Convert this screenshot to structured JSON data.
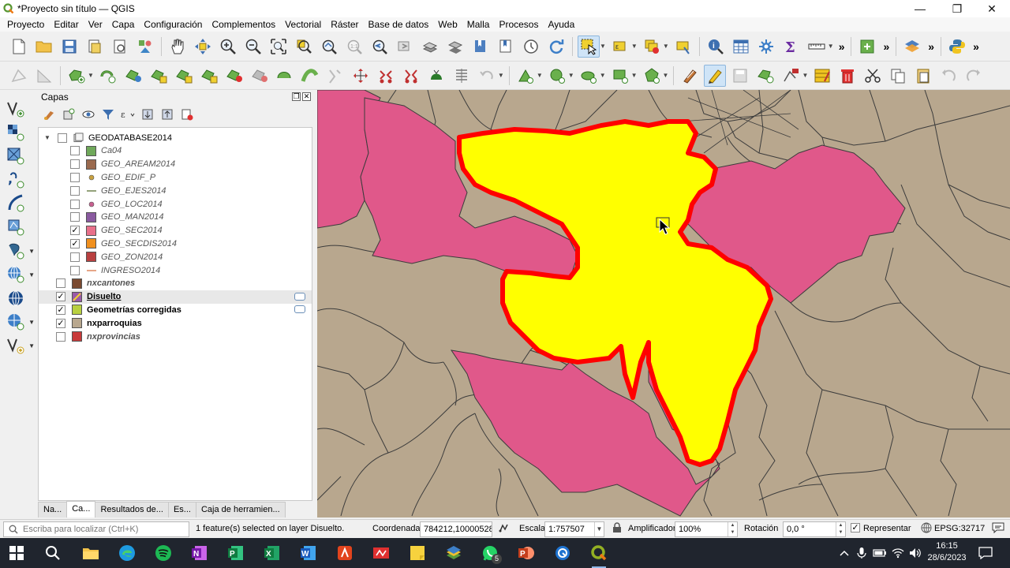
{
  "window": {
    "title": "*Proyecto sin título — QGIS",
    "minimize": "—",
    "restore": "❐",
    "close": "✕"
  },
  "menubar": [
    "Proyecto",
    "Editar",
    "Ver",
    "Capa",
    "Configuración",
    "Complementos",
    "Vectorial",
    "Ráster",
    "Base de datos",
    "Web",
    "Malla",
    "Procesos",
    "Ayuda"
  ],
  "layers_panel": {
    "title": "Capas",
    "tree": [
      {
        "name": "GEODATABASE2014",
        "type": "group",
        "checked": false,
        "level": 0,
        "style": "normal"
      },
      {
        "name": "Ca04",
        "type": "polygon",
        "color": "#6fa85a",
        "checked": false,
        "level": 1,
        "style": "italic"
      },
      {
        "name": "GEO_AREAM2014",
        "type": "polygon",
        "color": "#9a6a4e",
        "checked": false,
        "level": 1,
        "style": "italic"
      },
      {
        "name": "GEO_EDIF_P",
        "type": "point",
        "color": "#c8a040",
        "checked": false,
        "level": 1,
        "style": "italic"
      },
      {
        "name": "GEO_EJES2014",
        "type": "line",
        "color": "#7a8a5a",
        "checked": false,
        "level": 1,
        "style": "italic"
      },
      {
        "name": "GEO_LOC2014",
        "type": "point",
        "color": "#c86090",
        "checked": false,
        "level": 1,
        "style": "italic"
      },
      {
        "name": "GEO_MAN2014",
        "type": "polygon",
        "color": "#8a5aa0",
        "checked": false,
        "level": 1,
        "style": "italic"
      },
      {
        "name": "GEO_SEC2014",
        "type": "polygon",
        "color": "#e8708a",
        "checked": true,
        "level": 1,
        "style": "italic"
      },
      {
        "name": "GEO_SECDIS2014",
        "type": "polygon",
        "color": "#f0901e",
        "checked": true,
        "level": 1,
        "style": "italic"
      },
      {
        "name": "GEO_ZON2014",
        "type": "polygon",
        "color": "#b84040",
        "checked": false,
        "level": 1,
        "style": "italic"
      },
      {
        "name": "INGRESO2014",
        "type": "line",
        "color": "#e0906a",
        "checked": false,
        "level": 1,
        "style": "italic"
      },
      {
        "name": "nxcantones",
        "type": "polygon",
        "color": "#7a4a30",
        "checked": false,
        "level": 0,
        "style": "italic-bold"
      },
      {
        "name": "Disuelto",
        "type": "polygon-selected",
        "color": "#9a5aa8",
        "checked": true,
        "level": 0,
        "style": "bold-underline",
        "editing": true
      },
      {
        "name": "Geometrías corregidas",
        "type": "polygon",
        "color": "#b8d040",
        "checked": true,
        "level": 0,
        "style": "bold",
        "editing": true
      },
      {
        "name": "nxparroquias",
        "type": "polygon",
        "color": "#b8a78e",
        "checked": true,
        "level": 0,
        "style": "bold"
      },
      {
        "name": "nxprovincias",
        "type": "polygon",
        "color": "#c83a3a",
        "checked": false,
        "level": 0,
        "style": "italic-bold"
      }
    ],
    "tabs": [
      "Na...",
      "Ca...",
      "Resultados de...",
      "Es...",
      "Caja de herramien..."
    ],
    "active_tab": 1
  },
  "statusbar": {
    "search_placeholder": "Escriba para localizar (Ctrl+K)",
    "message": "1 feature(s) selected on layer Disuelto.",
    "coord_label": "Coordenada",
    "coord_value": "784212,10000528",
    "scale_label": "Escala",
    "scale_value": "1:757507",
    "magnifier_label": "Amplificador",
    "magnifier_value": "100%",
    "rotation_label": "Rotación",
    "rotation_value": "0,0 °",
    "render_label": "Representar",
    "render_checked": true,
    "crs": "EPSG:32717"
  },
  "taskbar": {
    "time": "16:15",
    "date": "28/6/2023",
    "whatsapp_badge": "5"
  },
  "colors": {
    "map_background": "#b8a78e",
    "selected_fill": "#ffff00",
    "selected_outline": "#ff0000",
    "sector_fill": "#e0588a",
    "boundary": "#3c3c3c"
  }
}
